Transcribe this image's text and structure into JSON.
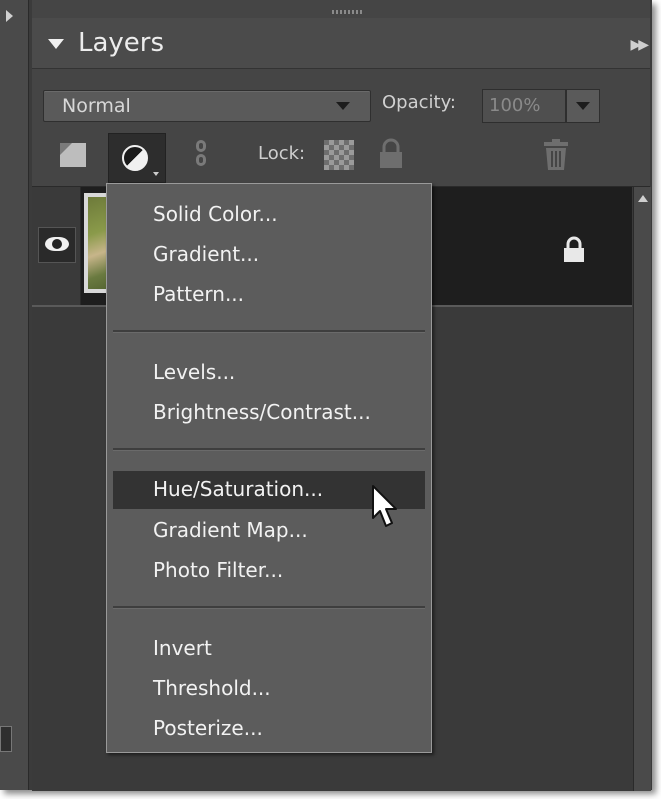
{
  "panel": {
    "title": "Layers",
    "blend_mode": "Normal",
    "opacity_label": "Opacity:",
    "opacity_value": "100%",
    "lock_label": "Lock:"
  },
  "menu": {
    "group1": [
      "Solid Color...",
      "Gradient...",
      "Pattern..."
    ],
    "group2": [
      "Levels...",
      "Brightness/Contrast..."
    ],
    "group3": [
      "Hue/Saturation...",
      "Gradient Map...",
      "Photo Filter..."
    ],
    "group4": [
      "Invert",
      "Threshold...",
      "Posterize..."
    ],
    "highlighted": "Hue/Saturation..."
  },
  "colors": {
    "panel_bg": "#454545",
    "menu_bg": "#5c5c5c",
    "highlight_bg": "#333333",
    "menu_text": "#f2f2f2"
  }
}
